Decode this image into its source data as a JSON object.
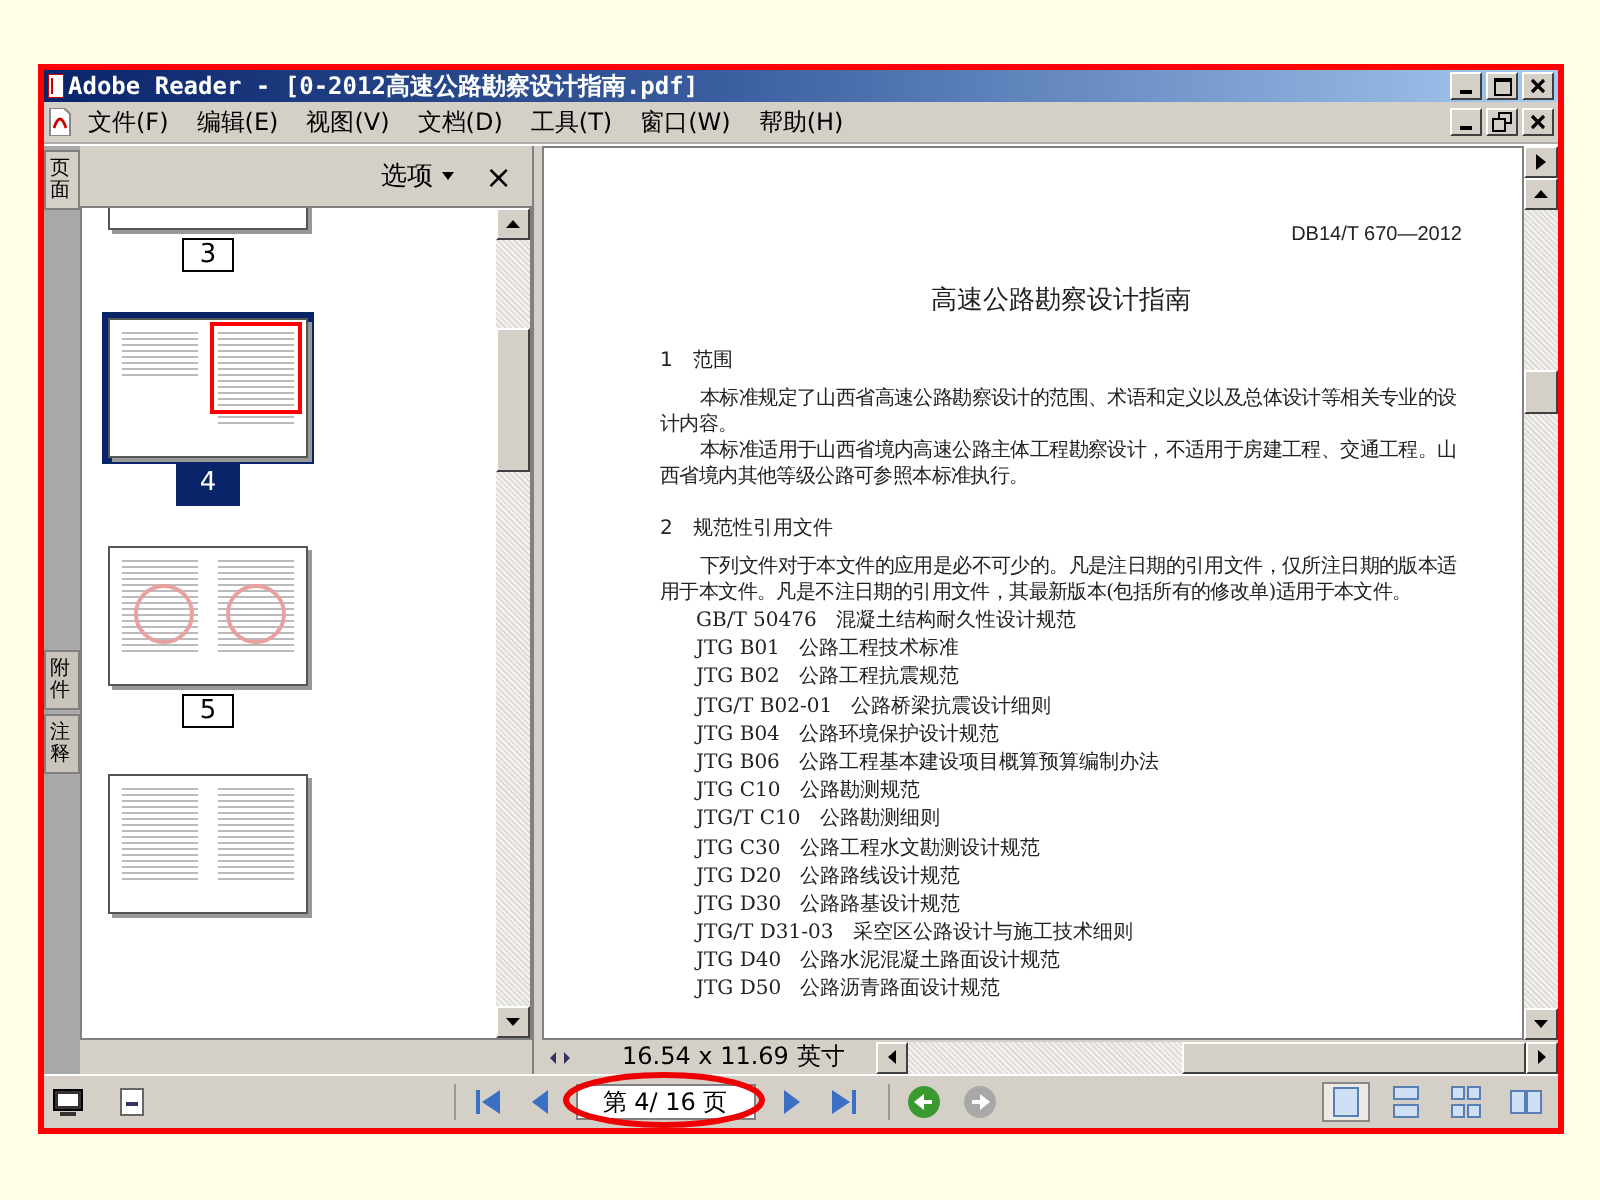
{
  "window": {
    "title": "Adobe Reader - [0-2012高速公路勘察设计指南.pdf]"
  },
  "menu": [
    {
      "label": "文件(F)"
    },
    {
      "label": "编辑(E)"
    },
    {
      "label": "视图(V)"
    },
    {
      "label": "文档(D)"
    },
    {
      "label": "工具(T)"
    },
    {
      "label": "窗口(W)"
    },
    {
      "label": "帮助(H)"
    }
  ],
  "panel": {
    "options": "选项",
    "close": "×"
  },
  "side_tabs": [
    {
      "label": "页面",
      "selected": true
    },
    {
      "label": "附件",
      "selected": false
    },
    {
      "label": "注释",
      "selected": false
    }
  ],
  "thumbnails": [
    {
      "label": "3",
      "selected": false,
      "kind": "text"
    },
    {
      "label": "4",
      "selected": true,
      "kind": "split"
    },
    {
      "label": "5",
      "selected": false,
      "kind": "stamped"
    },
    {
      "selected": false,
      "kind": "dense"
    }
  ],
  "document": {
    "code": "DB14/T 670—2012",
    "title": "高速公路勘察设计指南",
    "sections": [
      {
        "heading": "1　范围",
        "paragraphs": [
          "本标准规定了山西省高速公路勘察设计的范围、术语和定义以及总体设计等相关专业的设计内容。",
          "本标准适用于山西省境内高速公路主体工程勘察设计，不适用于房建工程、交通工程。山西省境内其他等级公路可参照本标准执行。"
        ]
      },
      {
        "heading": "2　规范性引用文件",
        "paragraphs": [
          "下列文件对于本文件的应用是必不可少的。凡是注日期的引用文件，仅所注日期的版本适用于本文件。凡是不注日期的引用文件，其最新版本(包括所有的修改单)适用于本文件。"
        ],
        "references": [
          {
            "code": "GB/T 50476",
            "name": "混凝土结构耐久性设计规范"
          },
          {
            "code": "JTG B01",
            "name": "公路工程技术标准"
          },
          {
            "code": "JTG B02",
            "name": "公路工程抗震规范"
          },
          {
            "code": "JTG/T B02-01",
            "name": "公路桥梁抗震设计细则"
          },
          {
            "code": "JTG B04",
            "name": "公路环境保护设计规范"
          },
          {
            "code": "JTG B06",
            "name": "公路工程基本建设项目概算预算编制办法"
          },
          {
            "code": "JTG C10",
            "name": "公路勘测规范"
          },
          {
            "code": "JTG/T C10",
            "name": "公路勘测细则"
          },
          {
            "code": "JTG C30",
            "name": "公路工程水文勘测设计规范"
          },
          {
            "code": "JTG D20",
            "name": "公路路线设计规范"
          },
          {
            "code": "JTG D30",
            "name": "公路路基设计规范"
          },
          {
            "code": "JTG/T D31-03",
            "name": "采空区公路设计与施工技术细则"
          },
          {
            "code": "JTG D40",
            "name": "公路水泥混凝土路面设计规范"
          },
          {
            "code": "JTG D50",
            "name": "公路沥青路面设计规范"
          }
        ]
      }
    ]
  },
  "status": {
    "page_size": "16.54 x 11.69 英寸",
    "page_field": "第 4/ 16 页"
  },
  "view_modes": [
    {
      "kind": "single",
      "selected": true
    },
    {
      "kind": "continuous",
      "selected": false
    },
    {
      "kind": "continuous-facing",
      "selected": false
    },
    {
      "kind": "facing",
      "selected": false
    }
  ]
}
